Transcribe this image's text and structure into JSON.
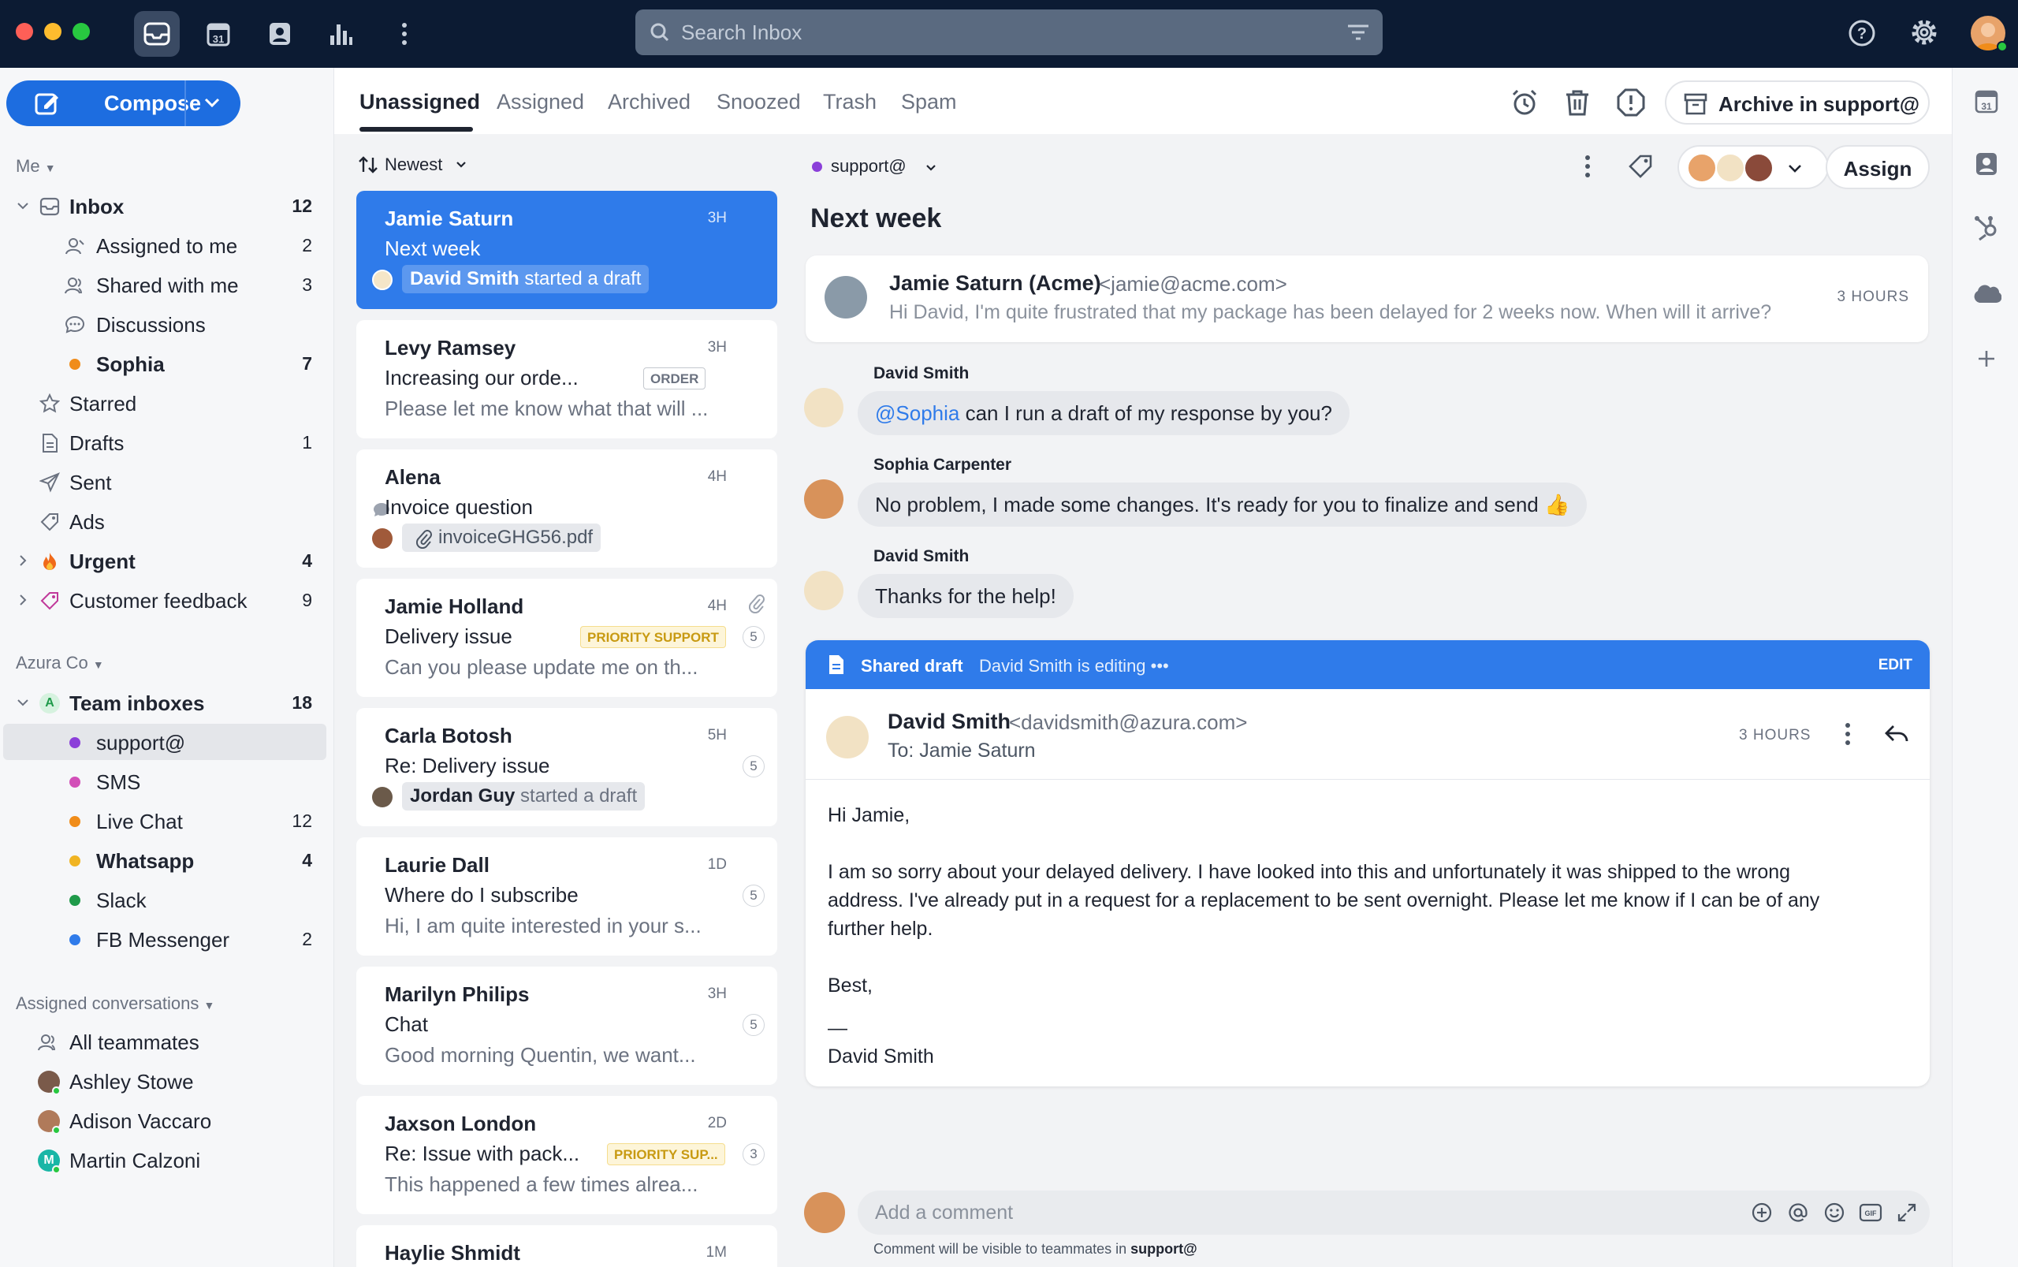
{
  "search": {
    "placeholder": "Search Inbox"
  },
  "compose": {
    "label": "Compose"
  },
  "sidebar": {
    "me_label": "Me",
    "inbox": {
      "label": "Inbox",
      "count": "12"
    },
    "inbox_items": [
      {
        "label": "Assigned to me",
        "count": "2"
      },
      {
        "label": "Shared with me",
        "count": "3"
      },
      {
        "label": "Discussions",
        "count": ""
      },
      {
        "label": "Sophia",
        "count": "7"
      }
    ],
    "folders": [
      {
        "label": "Starred",
        "count": ""
      },
      {
        "label": "Drafts",
        "count": "1"
      },
      {
        "label": "Sent",
        "count": ""
      },
      {
        "label": "Ads",
        "count": ""
      },
      {
        "label": "Urgent",
        "count": "4"
      },
      {
        "label": "Customer feedback",
        "count": "9"
      }
    ],
    "org_label": "Azura Co",
    "team_inboxes": {
      "label": "Team inboxes",
      "count": "18",
      "avatar": "A"
    },
    "team_items": [
      {
        "label": "support@",
        "count": "",
        "color": "#8b3fd9"
      },
      {
        "label": "SMS",
        "count": "",
        "color": "#d24fb8"
      },
      {
        "label": "Live Chat",
        "count": "12",
        "color": "#f08c1a"
      },
      {
        "label": "Whatsapp",
        "count": "4",
        "color": "#f0b423"
      },
      {
        "label": "Slack",
        "count": "",
        "color": "#1f9a4a"
      },
      {
        "label": "FB Messenger",
        "count": "2",
        "color": "#2f7bea"
      }
    ],
    "assigned_label": "Assigned conversations",
    "assigned_items": [
      {
        "label": "All teammates"
      },
      {
        "label": "Ashley Stowe"
      },
      {
        "label": "Adison Vaccaro"
      },
      {
        "label": "Martin Calzoni"
      }
    ]
  },
  "tabs": [
    "Unassigned",
    "Assigned",
    "Archived",
    "Snoozed",
    "Trash",
    "Spam"
  ],
  "toolbar": {
    "archive_label": "Archive in support@",
    "assign_label": "Assign"
  },
  "list": {
    "sort_label": "Newest",
    "items": [
      {
        "name": "Jamie Saturn",
        "time": "3H",
        "subject": "Next week",
        "chip_bold": "David Smith",
        "chip_rest": " started a draft"
      },
      {
        "name": "Levy Ramsey",
        "time": "3H",
        "subject": "Increasing our orde...",
        "tag": "ORDER",
        "preview": "Please let me know what that will ..."
      },
      {
        "name": "Alena",
        "time": "4H",
        "subject": "Invoice question",
        "attachment": "invoiceGHG56.pdf"
      },
      {
        "name": "Jamie Holland",
        "time": "4H",
        "subject": "Delivery issue",
        "tag": "PRIORITY SUPPORT",
        "badge": "5",
        "preview": "Can you please update me on th..."
      },
      {
        "name": "Carla Botosh",
        "time": "5H",
        "subject": "Re: Delivery issue",
        "badge": "5",
        "chip_bold": "Jordan Guy",
        "chip_rest": " started a draft"
      },
      {
        "name": "Laurie Dall",
        "time": "1D",
        "subject": "Where do I subscribe",
        "badge": "5",
        "preview": "Hi, I am quite interested in your s..."
      },
      {
        "name": "Marilyn Philips",
        "time": "3H",
        "subject": "Chat",
        "badge": "5",
        "preview": "Good morning Quentin, we want..."
      },
      {
        "name": "Jaxson London",
        "time": "2D",
        "subject": "Re: Issue with pack...",
        "tag": "PRIORITY SUP...",
        "badge": "3",
        "preview": "This happened a few times alrea..."
      },
      {
        "name": "Haylie Shmidt",
        "time": "1M"
      }
    ]
  },
  "conversation": {
    "inbox": "support@",
    "title": "Next week",
    "first_message": {
      "sender": "Jamie Saturn (Acme)",
      "email": "<jamie@acme.com>",
      "preview": "Hi David, I'm quite frustrated that my package has been delayed for 2 weeks now. When will it arrive?",
      "time": "3 HOURS"
    },
    "comments": [
      {
        "author": "David Smith",
        "mention": "@Sophia",
        "text": " can I run a draft of my response by you?"
      },
      {
        "author": "Sophia Carpenter",
        "mention": "",
        "text": "No problem, I made some changes. It's ready for you to finalize and send 👍"
      },
      {
        "author": "David Smith",
        "mention": "",
        "text": "Thanks for the help!"
      }
    ],
    "draft": {
      "label": "Shared draft",
      "status": "David Smith is editing •••",
      "edit": "EDIT",
      "sender": "David Smith",
      "email": "<davidsmith@azura.com>",
      "to": "To: Jamie Saturn",
      "time": "3 HOURS",
      "body": [
        "Hi Jamie,",
        "I am so sorry about your delayed delivery. I have looked into this and unfortunately it was shipped to the wrong",
        "address. I've already put in a request for a replacement to be sent overnight. Please let me know if I can be of any",
        "further help.",
        "Best,",
        "—",
        "David Smith"
      ]
    },
    "comment_box": {
      "placeholder": "Add a comment",
      "note_prefix": "Comment will be visible to teammates in ",
      "note_inbox": "support@"
    }
  }
}
